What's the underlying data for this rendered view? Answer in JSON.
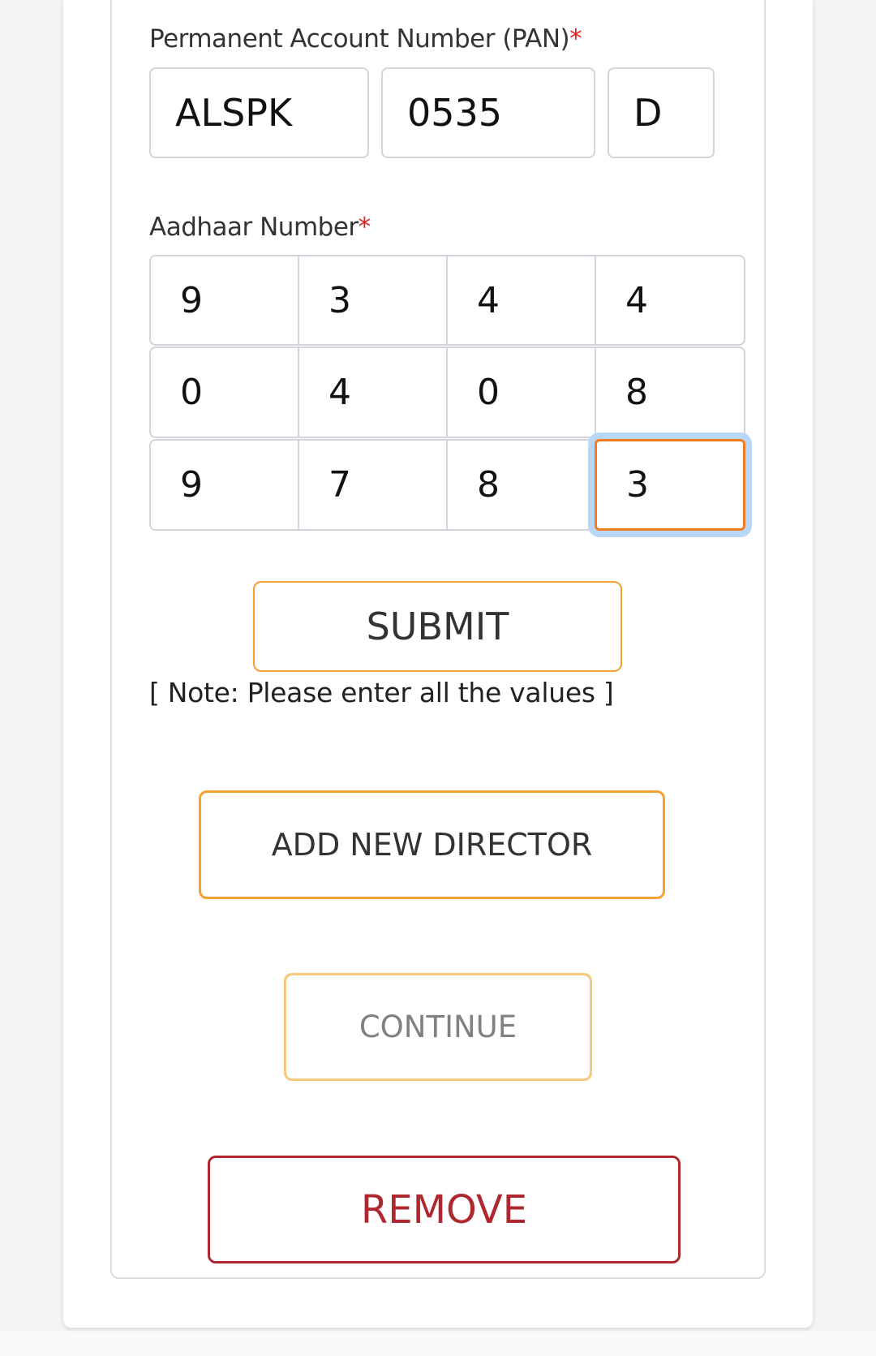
{
  "pan": {
    "label": "Permanent Account Number (PAN)",
    "required_mark": "*",
    "parts": [
      "ALSPK",
      "0535",
      "D"
    ]
  },
  "aadhaar": {
    "label": "Aadhaar Number",
    "required_mark": "*",
    "digits": [
      "9",
      "3",
      "4",
      "4",
      "0",
      "4",
      "0",
      "8",
      "9",
      "7",
      "8",
      "3"
    ]
  },
  "buttons": {
    "submit": "SUBMIT",
    "add_director": "ADD NEW DIRECTOR",
    "continue": "CONTINUE",
    "remove": "REMOVE"
  },
  "note": "[ Note: Please enter all the values ]",
  "colors": {
    "accent": "#f5a030",
    "danger": "#b0282f",
    "focus_ring": "#b9d8f8",
    "required": "#e02020"
  }
}
